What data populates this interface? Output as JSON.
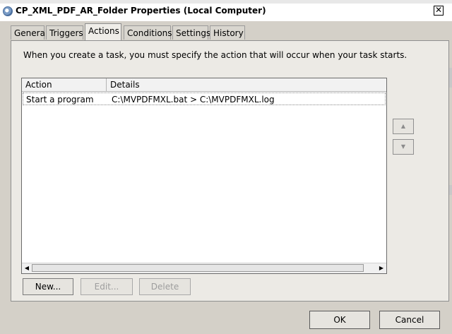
{
  "window": {
    "title": "CP_XML_PDF_AR_Folder Properties (Local Computer)",
    "close_glyph": "✕"
  },
  "tabs": [
    {
      "label": "General"
    },
    {
      "label": "Triggers"
    },
    {
      "label": "Actions",
      "active": true
    },
    {
      "label": "Conditions"
    },
    {
      "label": "Settings"
    },
    {
      "label": "History"
    }
  ],
  "actions_tab": {
    "description": "When you create a task, you must specify the action that will occur when your task starts.",
    "columns": [
      "Action",
      "Details"
    ],
    "rows": [
      {
        "action": "Start a program",
        "details": "C:\\MVPDFMXL.bat > C:\\MVPDFMXL.log"
      }
    ],
    "move_up_glyph": "▲",
    "move_down_glyph": "▼",
    "scroll_left_glyph": "◀",
    "scroll_right_glyph": "▶",
    "buttons": {
      "new": "New...",
      "edit": "Edit...",
      "delete": "Delete"
    }
  },
  "dialog_buttons": {
    "ok": "OK",
    "cancel": "Cancel"
  }
}
